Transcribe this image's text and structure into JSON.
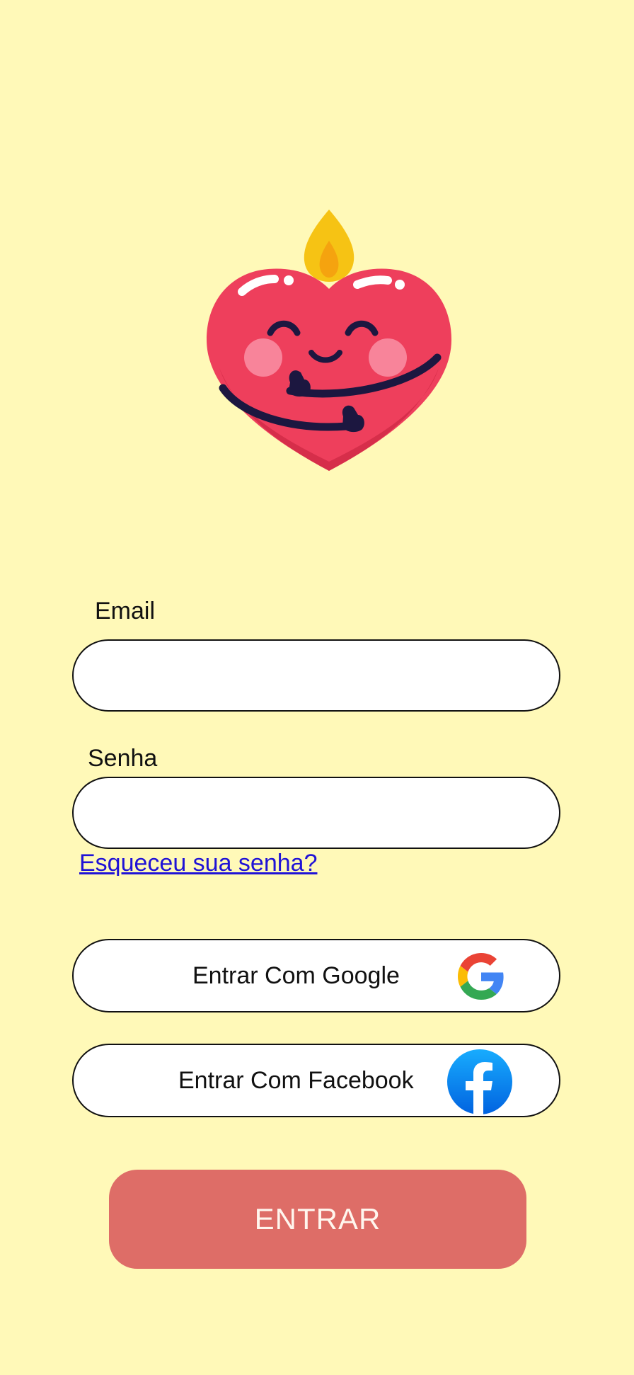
{
  "colors": {
    "background": "#FFF9B8",
    "primary_button": "#DE6D67",
    "link": "#1F12D6"
  },
  "mascot": {
    "icon": "heart-candle-hug-icon"
  },
  "form": {
    "email_label": "Email",
    "email_value": "",
    "password_label": "Senha",
    "password_value": "",
    "forgot_link": "Esqueceu sua senha?"
  },
  "social": {
    "google_label": "Entrar Com Google",
    "google_icon": "google-icon",
    "facebook_label": "Entrar Com Facebook",
    "facebook_icon": "facebook-icon"
  },
  "submit": {
    "label": "ENTRAR"
  }
}
